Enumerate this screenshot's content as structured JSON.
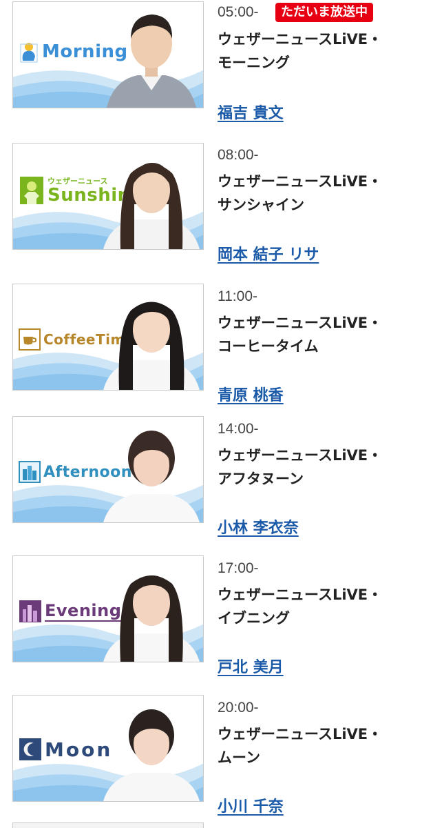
{
  "badge": "ただいま放送中",
  "programs": [
    {
      "time": "05:00-",
      "title_line1": "ウェザーニュースLiVE・",
      "title_line2": "モーニング",
      "caster": "福吉 貴文",
      "logo": "Morning",
      "logo_icon": "rooster-sun-icon",
      "logo_color": "#3a8fd6"
    },
    {
      "time": "08:00-",
      "title_line1": "ウェザーニュースLiVE・",
      "title_line2": "サンシャイン",
      "caster": "岡本 結子 リサ",
      "logo": "Sunshine",
      "logo_sub": "ウェザーニュース",
      "logo_icon": "sun-shirt-icon",
      "logo_color": "#7ab51d"
    },
    {
      "time": "11:00-",
      "title_line1": "ウェザーニュースLiVE・",
      "title_line2": "コーヒータイム",
      "caster": "青原 桃香",
      "logo": "CoffeeTime",
      "logo_icon": "coffee-cup-icon",
      "logo_color": "#b8862b"
    },
    {
      "time": "14:00-",
      "title_line1": "ウェザーニュースLiVE・",
      "title_line2": "アフタヌーン",
      "caster": "小林 李衣奈",
      "logo": "Afternoon",
      "logo_icon": "city-buildings-icon",
      "logo_color": "#2f8fbf"
    },
    {
      "time": "17:00-",
      "title_line1": "ウェザーニュースLiVE・",
      "title_line2": "イブニング",
      "caster": "戸北 美月",
      "logo": "Evening",
      "logo_icon": "evening-city-icon",
      "logo_color": "#6b3a78"
    },
    {
      "time": "20:00-",
      "title_line1": "ウェザーニュースLiVE・",
      "title_line2": "ムーン",
      "caster": "小川 千奈",
      "logo": "Moon",
      "logo_icon": "crescent-moon-icon",
      "logo_color": "#2d4a7a"
    }
  ]
}
